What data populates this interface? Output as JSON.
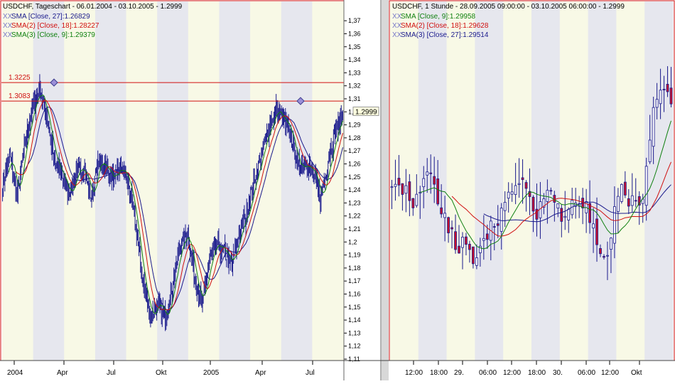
{
  "colors": {
    "candle_up": "#ffffff",
    "candle_down": "#1a1a8c",
    "candle_down_right": "#c8102e",
    "sma_blue": "#1a1a8c",
    "sma_red": "#d01010",
    "sma_green": "#108010",
    "level_line": "#d01010",
    "axis_text": "#000000",
    "band_light": "#f8f9e6",
    "band_dark": "#e6e7ee"
  },
  "icons": {
    "indicator_marker": "double-x-icon"
  },
  "left_panel": {
    "title": "USDCHF, Tageschart - 06.01.2004 - 03.10.2005 - 1.2999",
    "indicators": [
      {
        "label": "SMA [Close, 27]:1.26829",
        "color": "#1a1a8c"
      },
      {
        "label": "SMA(2) [Close, 18]:1.28227",
        "color": "#d01010"
      },
      {
        "label": "SMA(3) [Close, 9]:1.29379",
        "color": "#108010"
      }
    ],
    "levels": [
      {
        "label": "1.3225",
        "value": 1.3225
      },
      {
        "label": "1.3083",
        "value": 1.3083
      }
    ],
    "price_tag": "1.2999",
    "y_ticks": [
      "1,37",
      "1,36",
      "1,35",
      "1,34",
      "1,33",
      "1,32",
      "1,31",
      "1,3",
      "1,29",
      "1,28",
      "1,27",
      "1,26",
      "1,25",
      "1,24",
      "1,23",
      "1,22",
      "1,21",
      "1,2",
      "1,19",
      "1,18",
      "1,17",
      "1,16",
      "1,15",
      "1,14",
      "1,13",
      "1,12",
      "1,11"
    ],
    "x_ticks": [
      "2004",
      "Apr",
      "Jul",
      "Okt",
      "2005",
      "Apr",
      "Jul"
    ]
  },
  "right_panel": {
    "title": "USDCHF, 1 Stunde - 28.09.2005 09:00:00 - 03.10.2005 06:00:00 - 1.2999",
    "indicators": [
      {
        "label": "SMA [Close, 9]:1.29958",
        "color": "#108010"
      },
      {
        "label": "SMA(2) [Close, 18]:1.29628",
        "color": "#d01010"
      },
      {
        "label": "SMA(3) [Close, 27]:1.29514",
        "color": "#1a1a8c"
      }
    ],
    "x_ticks": [
      "12:00",
      "18:00",
      "29.",
      "06:00",
      "12:00",
      "18:00",
      "30.",
      "06:00",
      "12:00",
      "Okt"
    ]
  },
  "chart_data": [
    {
      "type": "candlestick",
      "title": "USDCHF, Tageschart - 06.01.2004 - 03.10.2005 - 1.2999",
      "ylim": [
        1.11,
        1.375
      ],
      "x_labels": [
        "2004",
        "Apr",
        "Jul",
        "Okt",
        "2005",
        "Apr",
        "Jul"
      ],
      "series": [
        {
          "name": "SMA [Close, 27]",
          "last": 1.26829
        },
        {
          "name": "SMA(2) [Close, 18]",
          "last": 1.28227
        },
        {
          "name": "SMA(3) [Close, 9]",
          "last": 1.29379
        }
      ],
      "anchor_closes": [
        1.245,
        1.265,
        1.235,
        1.275,
        1.302,
        1.318,
        1.296,
        1.262,
        1.252,
        1.237,
        1.252,
        1.258,
        1.233,
        1.262,
        1.258,
        1.247,
        1.257,
        1.246,
        1.212,
        1.168,
        1.143,
        1.152,
        1.142,
        1.167,
        1.197,
        1.207,
        1.172,
        1.152,
        1.187,
        1.197,
        1.192,
        1.182,
        1.207,
        1.222,
        1.247,
        1.267,
        1.288,
        1.302,
        1.292,
        1.282,
        1.257,
        1.262,
        1.252,
        1.232,
        1.262,
        1.283,
        1.2999
      ],
      "horizontal_levels": [
        1.3225,
        1.3083
      ],
      "last_price": 1.2999
    },
    {
      "type": "candlestick",
      "title": "USDCHF, 1 Stunde - 28.09.2005 09:00:00 - 03.10.2005 06:00:00 - 1.2999",
      "ylim": [
        1.11,
        1.375
      ],
      "x_labels": [
        "12:00",
        "18:00",
        "29.",
        "06:00",
        "12:00",
        "18:00",
        "30.",
        "06:00",
        "12:00",
        "Okt"
      ],
      "series": [
        {
          "name": "SMA [Close, 9]",
          "last": 1.29958
        },
        {
          "name": "SMA(2) [Close, 18]",
          "last": 1.29628
        },
        {
          "name": "SMA(3) [Close, 27]",
          "last": 1.29514
        }
      ],
      "anchor_closes": [
        1.245,
        1.24,
        1.246,
        1.226,
        1.236,
        1.256,
        1.237,
        1.222,
        1.212,
        1.19,
        1.2,
        1.187,
        1.195,
        1.208,
        1.212,
        1.222,
        1.23,
        1.236,
        1.253,
        1.23,
        1.222,
        1.232,
        1.243,
        1.226,
        1.222,
        1.236,
        1.23,
        1.23,
        1.212,
        1.195,
        1.185,
        1.22,
        1.24,
        1.235,
        1.227,
        1.232,
        1.282,
        1.31,
        1.322,
        1.3
      ],
      "last_price": 1.2999
    }
  ]
}
